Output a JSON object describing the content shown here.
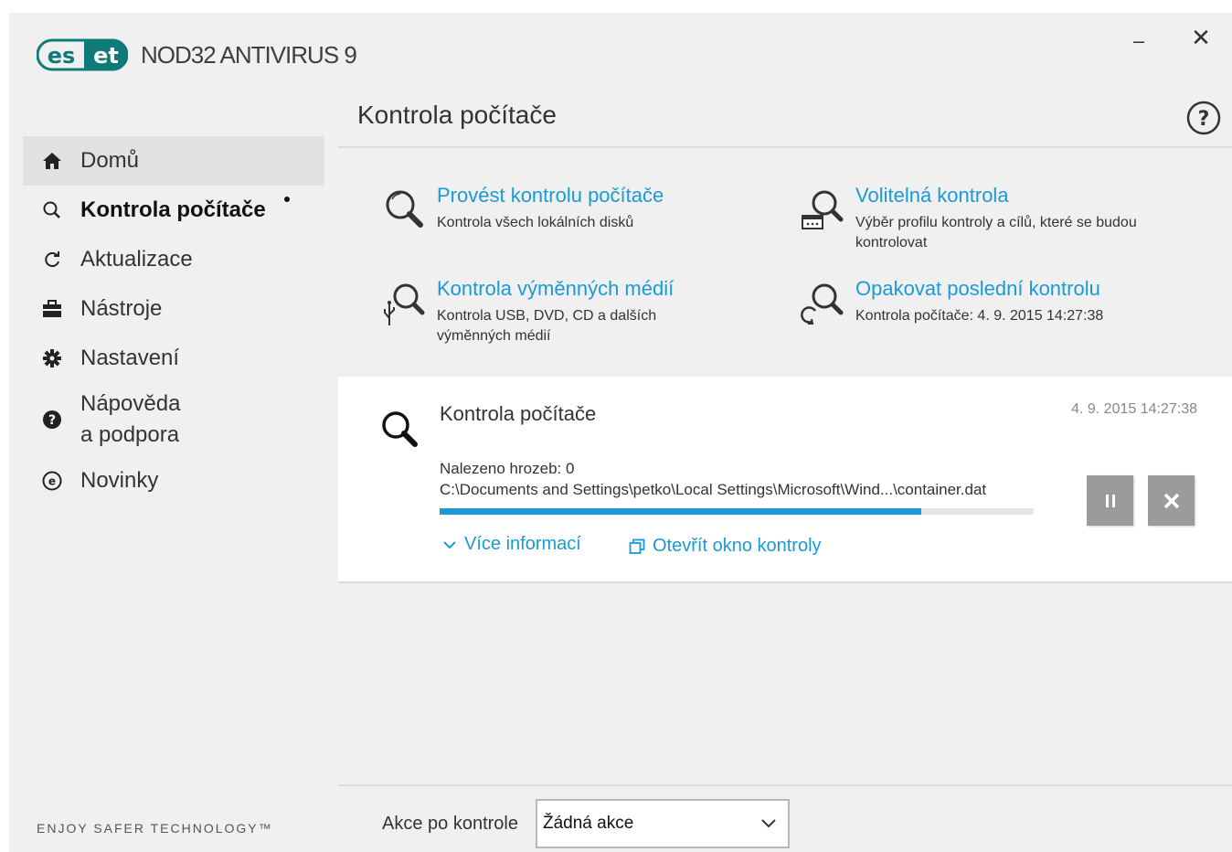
{
  "app": {
    "logo_text": "eset",
    "product_name": "NOD32 ANTIVIRUS 9",
    "minimize_glyph": "–",
    "close_glyph": "✕"
  },
  "sidebar": {
    "items": [
      {
        "label": "Domů",
        "icon": "home-icon"
      },
      {
        "label": "Kontrola počítače",
        "icon": "search-icon"
      },
      {
        "label": "Aktualizace",
        "icon": "refresh-icon"
      },
      {
        "label": "Nástroje",
        "icon": "toolbox-icon"
      },
      {
        "label": "Nastavení",
        "icon": "gear-icon"
      },
      {
        "label": "Nápověda",
        "label2": "a podpora",
        "icon": "help-icon"
      },
      {
        "label": "Novinky",
        "icon": "news-icon"
      }
    ],
    "tagline": "ENJOY SAFER TECHNOLOGY™"
  },
  "main": {
    "title": "Kontrola počítače",
    "actions": [
      {
        "title": "Provést kontrolu počítače",
        "desc": "Kontrola všech lokálních disků"
      },
      {
        "title": "Volitelná kontrola",
        "desc": "Výběr profilu kontroly a cílů, které se budou kontrolovat"
      },
      {
        "title": "Kontrola výměnných médií",
        "desc": "Kontrola USB, DVD, CD a dalších výměnných médií"
      },
      {
        "title": "Opakovat poslední kontrolu",
        "desc": "Kontrola počítače: 4. 9. 2015 14:27:38"
      }
    ],
    "scan": {
      "title": "Kontrola počítače",
      "date": "4. 9. 2015 14:27:38",
      "threats": "Nalezeno hrozeb: 0",
      "path": "C:\\Documents and Settings\\petko\\Local Settings\\Microsoft\\Wind...\\container.dat",
      "progress": 0.81,
      "more_link": "Více informací",
      "open_link": "Otevřít okno kontroly"
    },
    "footer": {
      "label": "Akce po kontrole",
      "selected": "Žádná akce"
    }
  },
  "colors": {
    "accent": "#1a9ad6",
    "logo_teal": "#0f7b78",
    "button_gray": "#9b9b9b"
  }
}
